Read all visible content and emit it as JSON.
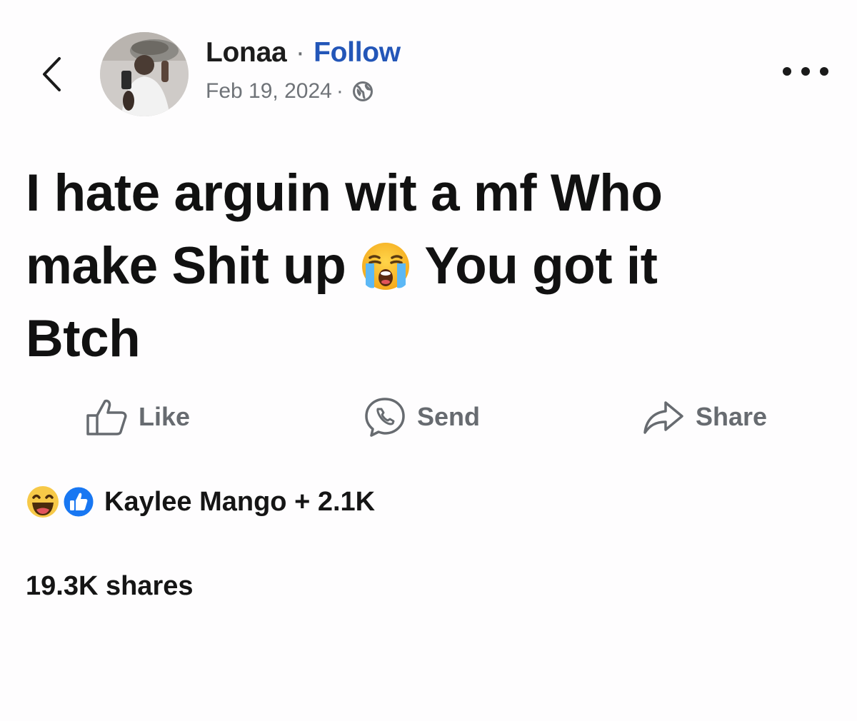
{
  "header": {
    "author_name": "Lonaa",
    "separator": "·",
    "follow_label": "Follow",
    "date": "Feb 19, 2024",
    "meta_separator": "·",
    "privacy_icon": "globe-icon",
    "back_icon": "chevron-left-icon",
    "more_icon": "more-horizontal-icon"
  },
  "post": {
    "lines": [
      "I hate arguin wit a mf Who",
      "make Shit up",
      "You got it",
      "Btch"
    ],
    "emoji": "loudly-crying-face-emoji"
  },
  "actions": {
    "like_label": "Like",
    "send_label": "Send",
    "share_label": "Share",
    "like_icon": "thumbs-up-icon",
    "send_icon": "messenger-icon",
    "share_icon": "share-arrow-icon"
  },
  "reactions": {
    "icons": [
      "haha-icon",
      "like-reaction-icon"
    ],
    "summary": "Kaylee Mango + 2.1K"
  },
  "shares": {
    "label": "19.3K shares"
  },
  "colors": {
    "follow_link": "#2356b8",
    "muted_text": "#6f7378",
    "action_text": "#676b70",
    "like_reaction_blue": "#1877f2",
    "haha_yellow": "#f7c948"
  }
}
